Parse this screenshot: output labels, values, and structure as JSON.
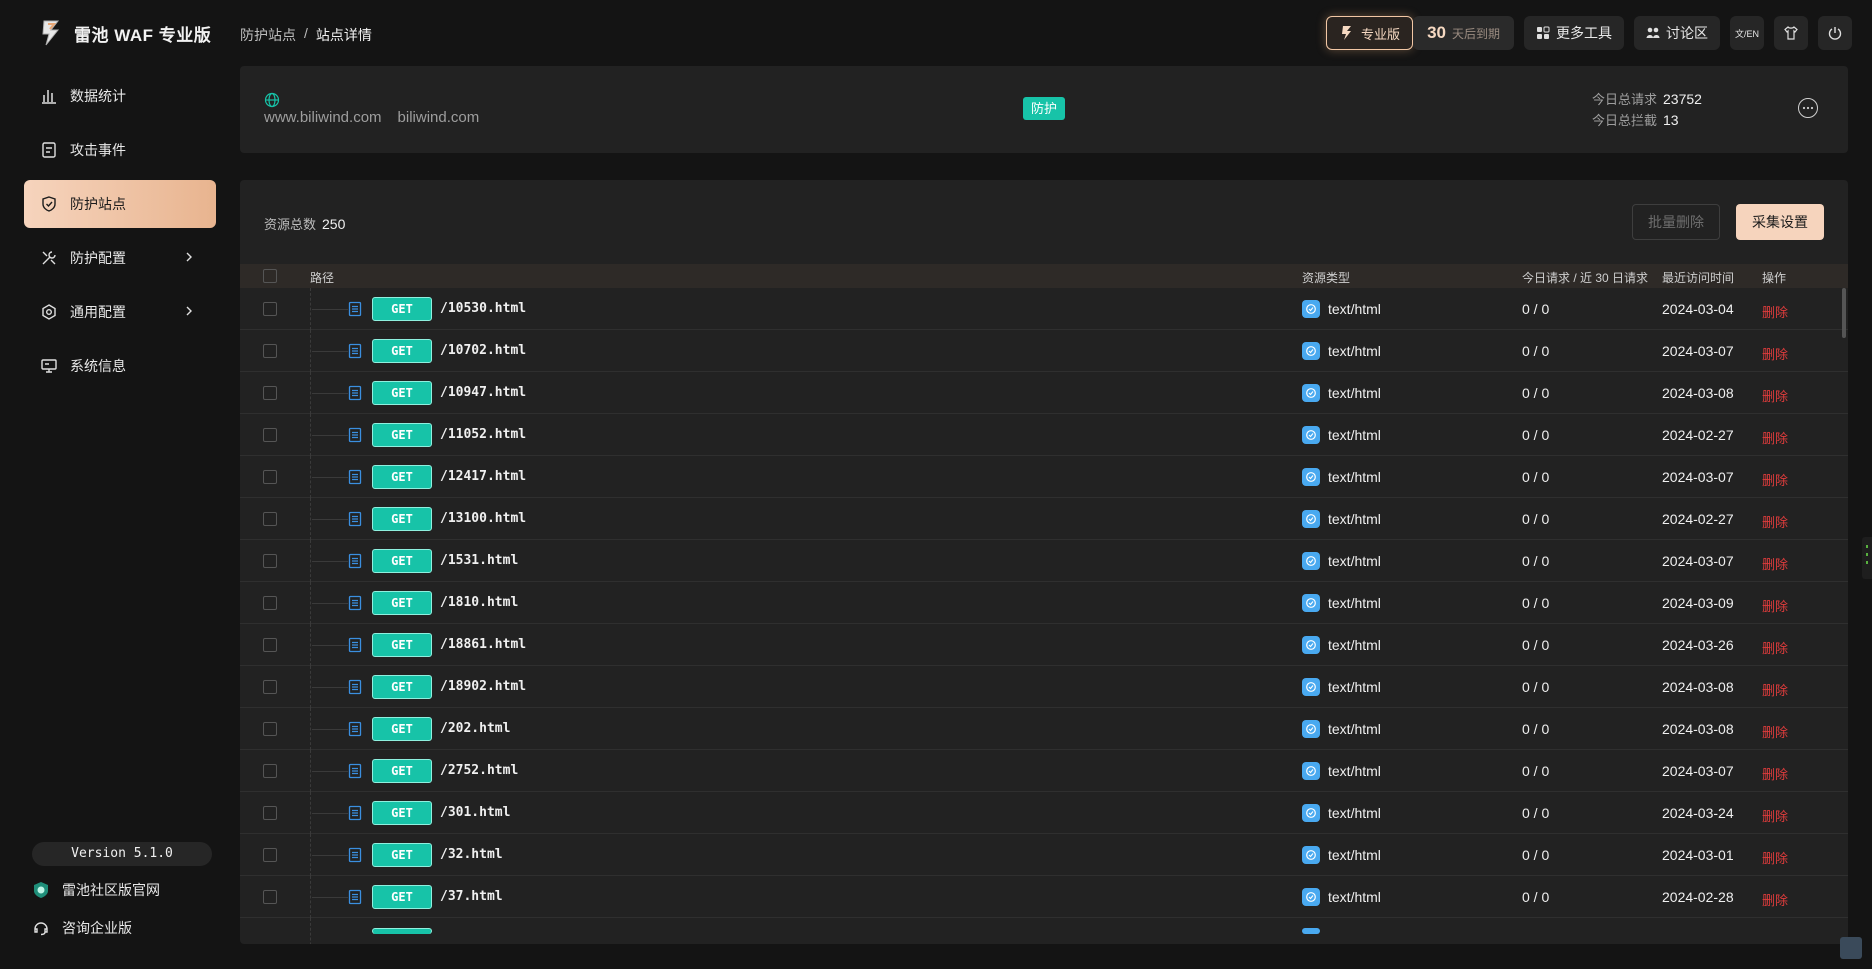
{
  "app": {
    "title": "雷池 WAF 专业版"
  },
  "sidebar": {
    "items": [
      {
        "label": "数据统计",
        "icon": "bar-chart-icon"
      },
      {
        "label": "攻击事件",
        "icon": "event-icon"
      },
      {
        "label": "防护站点",
        "icon": "shield-icon",
        "active": true
      },
      {
        "label": "防护配置",
        "icon": "tools-icon",
        "has_submenu": true
      },
      {
        "label": "通用配置",
        "icon": "settings-icon",
        "has_submenu": true
      },
      {
        "label": "系统信息",
        "icon": "monitor-icon"
      }
    ],
    "version": "Version 5.1.0",
    "footer": [
      {
        "label": "雷池社区版官网",
        "icon": "community-logo-icon"
      },
      {
        "label": "咨询企业版",
        "icon": "headset-icon"
      }
    ]
  },
  "breadcrumb": {
    "parent": "防护站点",
    "separator": "/",
    "current": "站点详情"
  },
  "topbar": {
    "pro_label": "专业版",
    "days_num": "30",
    "days_text": "天后到期",
    "more_tools": "更多工具",
    "forum": "讨论区",
    "lang_icon": "文/EN"
  },
  "site": {
    "domains": [
      "www.biliwind.com",
      "biliwind.com"
    ],
    "status": "防护",
    "status_color": "#17c3a8",
    "today_requests_label": "今日总请求",
    "today_requests": "23752",
    "today_blocked_label": "今日总拦截",
    "today_blocked": "13"
  },
  "resources": {
    "total_label": "资源总数",
    "total": "250",
    "batch_delete": "批量删除",
    "collect_settings": "采集设置",
    "columns": {
      "path": "路径",
      "type": "资源类型",
      "requests": "今日请求 / 近 30 日请求",
      "last_visit": "最近访问时间",
      "action": "操作"
    },
    "rows": [
      {
        "method": "GET",
        "path": "/10530.html",
        "type": "text/html",
        "requests": "0 / 0",
        "date": "2024-03-04",
        "action": "删除"
      },
      {
        "method": "GET",
        "path": "/10702.html",
        "type": "text/html",
        "requests": "0 / 0",
        "date": "2024-03-07",
        "action": "删除"
      },
      {
        "method": "GET",
        "path": "/10947.html",
        "type": "text/html",
        "requests": "0 / 0",
        "date": "2024-03-08",
        "action": "删除"
      },
      {
        "method": "GET",
        "path": "/11052.html",
        "type": "text/html",
        "requests": "0 / 0",
        "date": "2024-02-27",
        "action": "删除"
      },
      {
        "method": "GET",
        "path": "/12417.html",
        "type": "text/html",
        "requests": "0 / 0",
        "date": "2024-03-07",
        "action": "删除"
      },
      {
        "method": "GET",
        "path": "/13100.html",
        "type": "text/html",
        "requests": "0 / 0",
        "date": "2024-02-27",
        "action": "删除"
      },
      {
        "method": "GET",
        "path": "/1531.html",
        "type": "text/html",
        "requests": "0 / 0",
        "date": "2024-03-07",
        "action": "删除"
      },
      {
        "method": "GET",
        "path": "/1810.html",
        "type": "text/html",
        "requests": "0 / 0",
        "date": "2024-03-09",
        "action": "删除"
      },
      {
        "method": "GET",
        "path": "/18861.html",
        "type": "text/html",
        "requests": "0 / 0",
        "date": "2024-03-26",
        "action": "删除"
      },
      {
        "method": "GET",
        "path": "/18902.html",
        "type": "text/html",
        "requests": "0 / 0",
        "date": "2024-03-08",
        "action": "删除"
      },
      {
        "method": "GET",
        "path": "/202.html",
        "type": "text/html",
        "requests": "0 / 0",
        "date": "2024-03-08",
        "action": "删除"
      },
      {
        "method": "GET",
        "path": "/2752.html",
        "type": "text/html",
        "requests": "0 / 0",
        "date": "2024-03-07",
        "action": "删除"
      },
      {
        "method": "GET",
        "path": "/301.html",
        "type": "text/html",
        "requests": "0 / 0",
        "date": "2024-03-24",
        "action": "删除"
      },
      {
        "method": "GET",
        "path": "/32.html",
        "type": "text/html",
        "requests": "0 / 0",
        "date": "2024-03-01",
        "action": "删除"
      },
      {
        "method": "GET",
        "path": "/37.html",
        "type": "text/html",
        "requests": "0 / 0",
        "date": "2024-02-28",
        "action": "删除"
      }
    ]
  },
  "colors": {
    "accent": "#f6d4bd",
    "method_badge": "#17c3a8",
    "delete": "#e03c3c",
    "type_icon": "#49a9f0"
  }
}
